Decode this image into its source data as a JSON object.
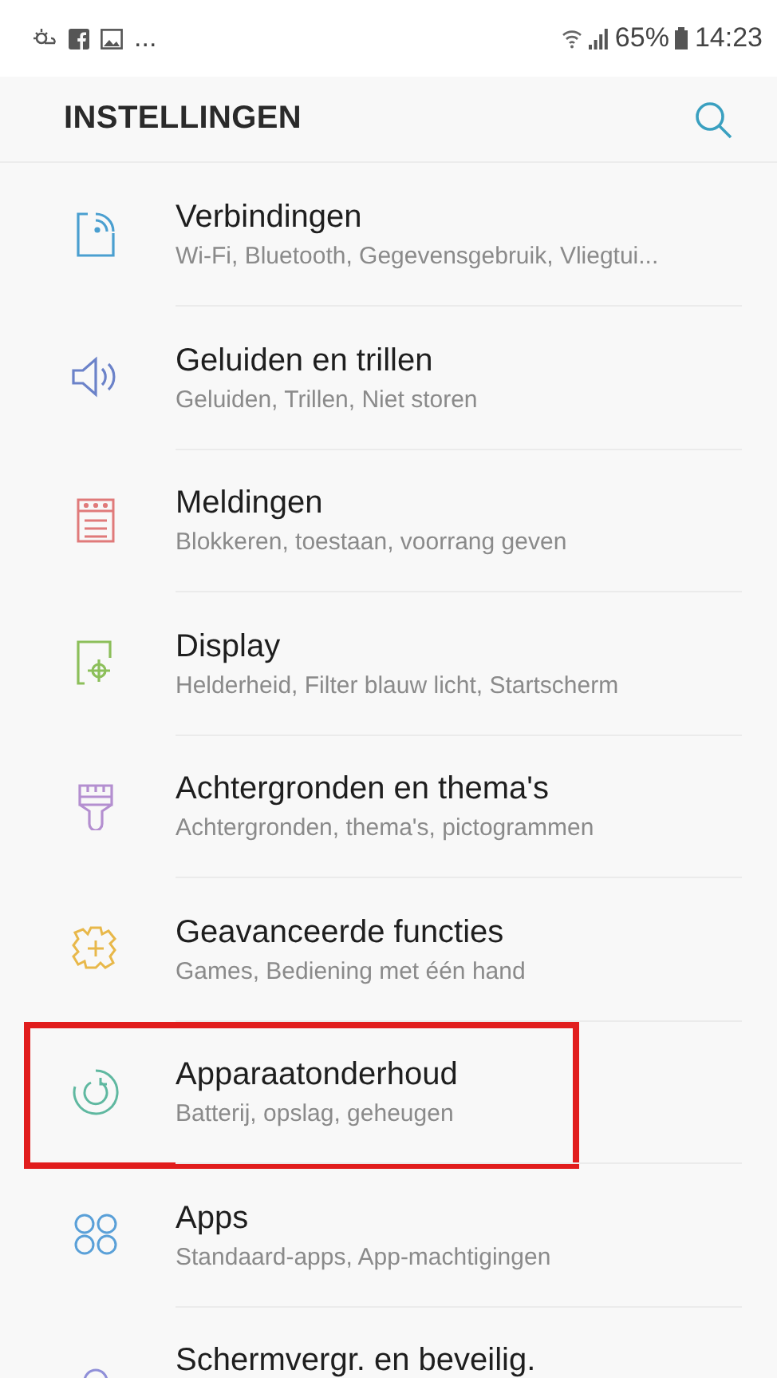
{
  "status_bar": {
    "overflow": "...",
    "battery": "65%",
    "time": "14:23"
  },
  "header": {
    "title": "INSTELLINGEN"
  },
  "items": [
    {
      "kind": "connections",
      "title": "Verbindingen",
      "subtitle": "Wi-Fi, Bluetooth, Gegevensgebruik, Vliegtui...",
      "color": "#4a9fd0",
      "highlighted": false
    },
    {
      "kind": "sound",
      "title": "Geluiden en trillen",
      "subtitle": "Geluiden, Trillen, Niet storen",
      "color": "#6b82c9",
      "highlighted": false
    },
    {
      "kind": "notifications",
      "title": "Meldingen",
      "subtitle": "Blokkeren, toestaan, voorrang geven",
      "color": "#e07a7a",
      "highlighted": false
    },
    {
      "kind": "display",
      "title": "Display",
      "subtitle": "Helderheid, Filter blauw licht, Startscherm",
      "color": "#8cbf5a",
      "highlighted": false
    },
    {
      "kind": "wallpaper",
      "title": "Achtergronden en thema's",
      "subtitle": "Achtergronden, thema's, pictogrammen",
      "color": "#b48fd0",
      "highlighted": false
    },
    {
      "kind": "advanced",
      "title": "Geavanceerde functies",
      "subtitle": "Games, Bediening met één hand",
      "color": "#e8b84a",
      "highlighted": false
    },
    {
      "kind": "maintenance",
      "title": "Apparaatonderhoud",
      "subtitle": "Batterij, opslag, geheugen",
      "color": "#5fb8a0",
      "highlighted": true
    },
    {
      "kind": "apps",
      "title": "Apps",
      "subtitle": "Standaard-apps, App-machtigingen",
      "color": "#5aa0d8",
      "highlighted": false
    },
    {
      "kind": "lock",
      "title": "Schermvergr. en beveilig.",
      "color": "#8f8fd8",
      "highlighted": false
    }
  ]
}
